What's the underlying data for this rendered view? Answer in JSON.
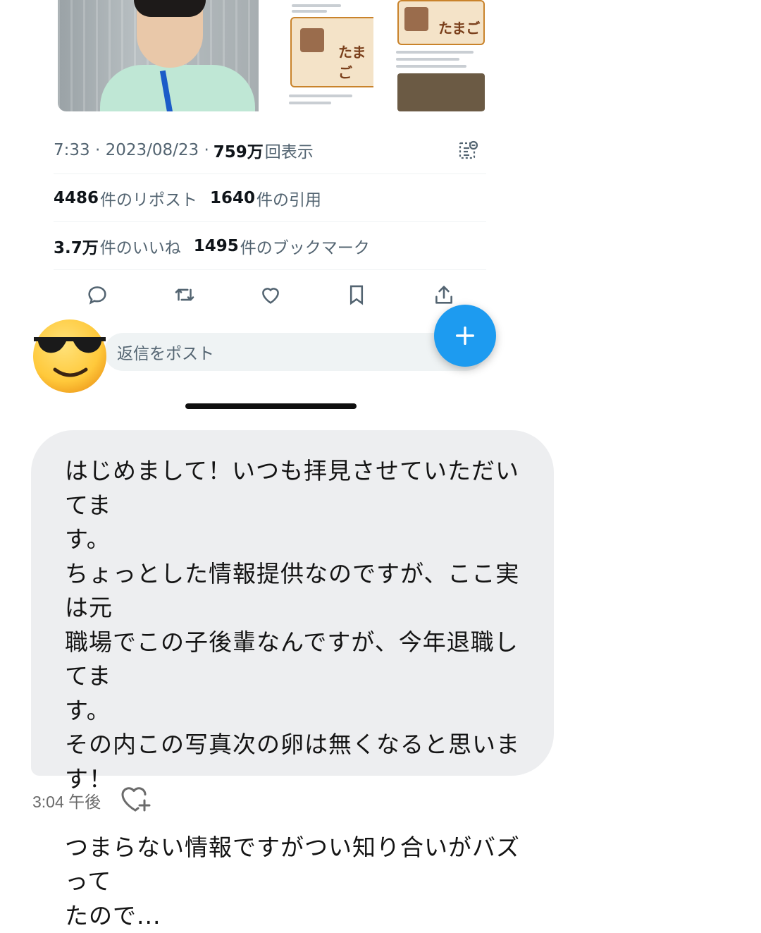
{
  "tweet": {
    "timestamp": "7:33 · 2023/08/23 · ",
    "views_count": "759万",
    "views_label": "回表示",
    "reposts_count": "4486",
    "reposts_label": "件のリポスト",
    "quotes_count": "1640",
    "quotes_label": "件の引用",
    "likes_count": "3.7万",
    "likes_label": "件のいいね",
    "bookmarks_count": "1495",
    "bookmarks_label": "件のブックマーク",
    "media_egg_text": "たまご",
    "actions": [
      "reply-icon",
      "retweet-icon",
      "heart-icon",
      "bookmark-icon",
      "share-icon"
    ]
  },
  "reply": {
    "placeholder": "返信をポスト"
  },
  "fab": {
    "icon": "plus-icon"
  },
  "dm": {
    "message": "はじめまして！いつも拝見させていただいてま\nす。\nちょっとした情報提供なのですが、ここ実は元\n職場でこの子後輩なんですが、今年退職してま\nす。\nその内この写真次の卵は無くなると思います！\n\nつまらない情報ですがつい知り合いがバズって\nたので...",
    "time": "3:04 午後"
  },
  "colors": {
    "accent": "#1d9bf0",
    "secondary_text": "#536471",
    "bubble": "#edeef0"
  }
}
